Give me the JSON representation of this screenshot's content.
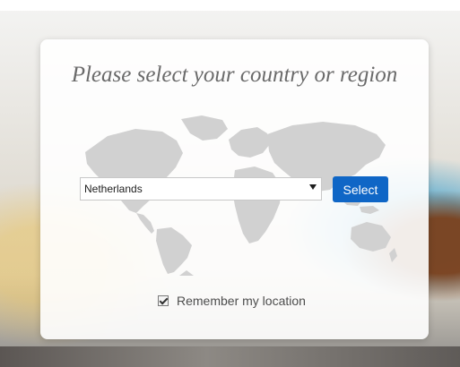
{
  "dialog": {
    "title": "Please select your country or region"
  },
  "country_select": {
    "value": "Netherlands"
  },
  "buttons": {
    "select": "Select"
  },
  "remember": {
    "label": "Remember my location",
    "checked": true
  },
  "colors": {
    "accent": "#0f66c6",
    "panel_background": "#ffffff",
    "map": "#cfcfcf",
    "title_text": "#6a6a6a"
  },
  "icons": {
    "dropdown": "chevron-down-icon",
    "checkbox": "checkmark-icon",
    "map": "world-map-icon"
  }
}
